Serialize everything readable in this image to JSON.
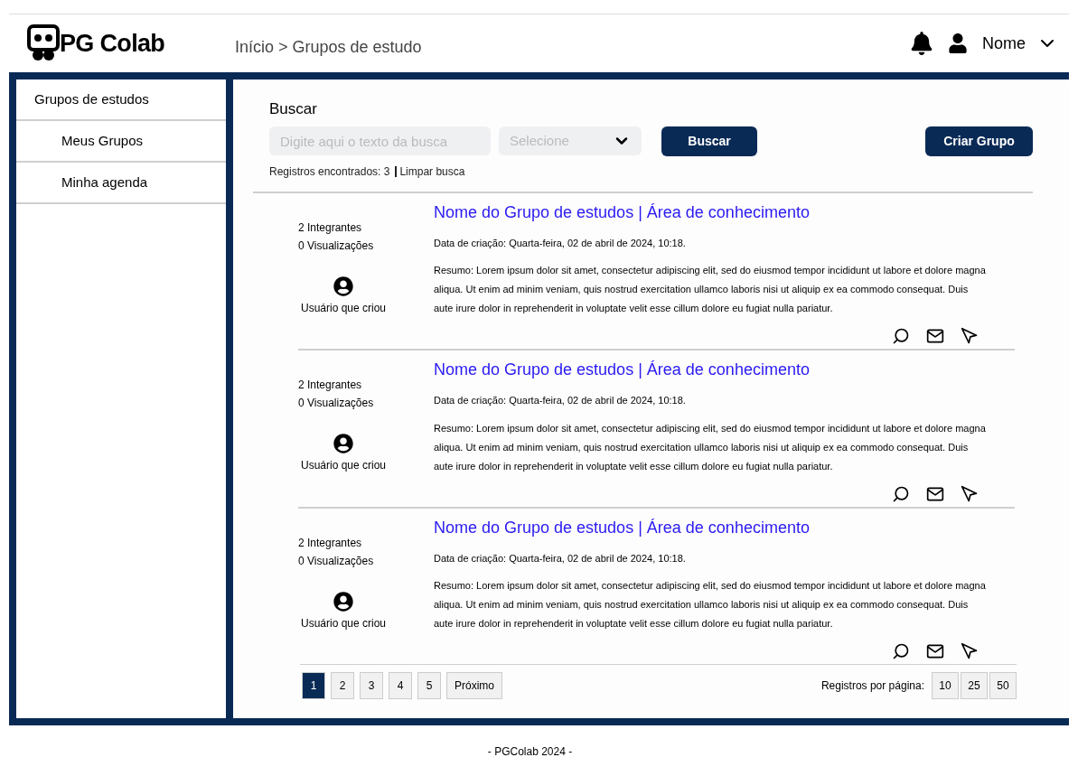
{
  "header": {
    "logo": "PG Colab",
    "breadcrumb": "Início > Grupos de estudo",
    "user_name": "Nome"
  },
  "sidebar": {
    "items": [
      {
        "label": "Grupos de estudos",
        "selected": false,
        "children": [
          {
            "label": "Meus Grupos",
            "selected": false
          },
          {
            "label": "Minha agenda",
            "selected": false
          }
        ]
      }
    ]
  },
  "search": {
    "title": "Buscar",
    "placeholder": "Digite aqui o texto da busca",
    "select_placeholder": "Selecione",
    "search_button": "Buscar",
    "create_button": "Criar Grupo",
    "results": "Registros encontrados: 3",
    "clear": "Limpar busca"
  },
  "groups": [
    {
      "members": "2 Integrantes",
      "views": "0 Visualizações",
      "creator": "Usuário que criou",
      "title": "Nome do Grupo de estudos | Área de conhecimento",
      "date": "Data de criação: Quarta-feira, 02 de abril de 2024, 10:18.",
      "summary": "Resumo: Lorem ipsum dolor sit amet, consectetur adipiscing elit, sed do eiusmod tempor incididunt ut labore et dolore magna aliqua. Ut enim ad minim veniam, quis nostrud exercitation ullamco laboris nisi ut aliquip ex ea commodo consequat. Duis aute irure dolor in reprehenderit in voluptate velit esse cillum dolore eu fugiat nulla pariatur."
    },
    {
      "members": "2 Integrantes",
      "views": "0 Visualizações",
      "creator": "Usuário que criou",
      "title": "Nome do Grupo de estudos | Área de conhecimento",
      "date": "Data de criação: Quarta-feira, 02 de abril de 2024, 10:18.",
      "summary": "Resumo: Lorem ipsum dolor sit amet, consectetur adipiscing elit, sed do eiusmod tempor incididunt ut labore et dolore magna aliqua. Ut enim ad minim veniam, quis nostrud exercitation ullamco laboris nisi ut aliquip ex ea commodo consequat. Duis aute irure dolor in reprehenderit in voluptate velit esse cillum dolore eu fugiat nulla pariatur."
    },
    {
      "members": "2 Integrantes",
      "views": "0 Visualizações",
      "creator": "Usuário que criou",
      "title": "Nome do Grupo de estudos | Área de conhecimento",
      "date": "Data de criação: Quarta-feira, 02 de abril de 2024, 10:18.",
      "summary": "Resumo: Lorem ipsum dolor sit amet, consectetur adipiscing elit, sed do eiusmod tempor incididunt ut labore et dolore magna aliqua. Ut enim ad minim veniam, quis nostrud exercitation ullamco laboris nisi ut aliquip ex ea commodo consequat. Duis aute irure dolor in reprehenderit in voluptate velit esse cillum dolore eu fugiat nulla pariatur."
    }
  ],
  "pagination": {
    "pages": [
      {
        "label": "1",
        "selected": true
      },
      {
        "label": "2",
        "selected": false
      },
      {
        "label": "3",
        "selected": false
      },
      {
        "label": "4",
        "selected": false
      },
      {
        "label": "5",
        "selected": false
      }
    ],
    "next": "Próximo",
    "per_page_label": "Registros por página:",
    "per_page": [
      {
        "label": "10",
        "selected": false
      },
      {
        "label": "25",
        "selected": false
      },
      {
        "label": "50",
        "selected": false
      }
    ]
  },
  "footer": "- PGColab 2024 -"
}
